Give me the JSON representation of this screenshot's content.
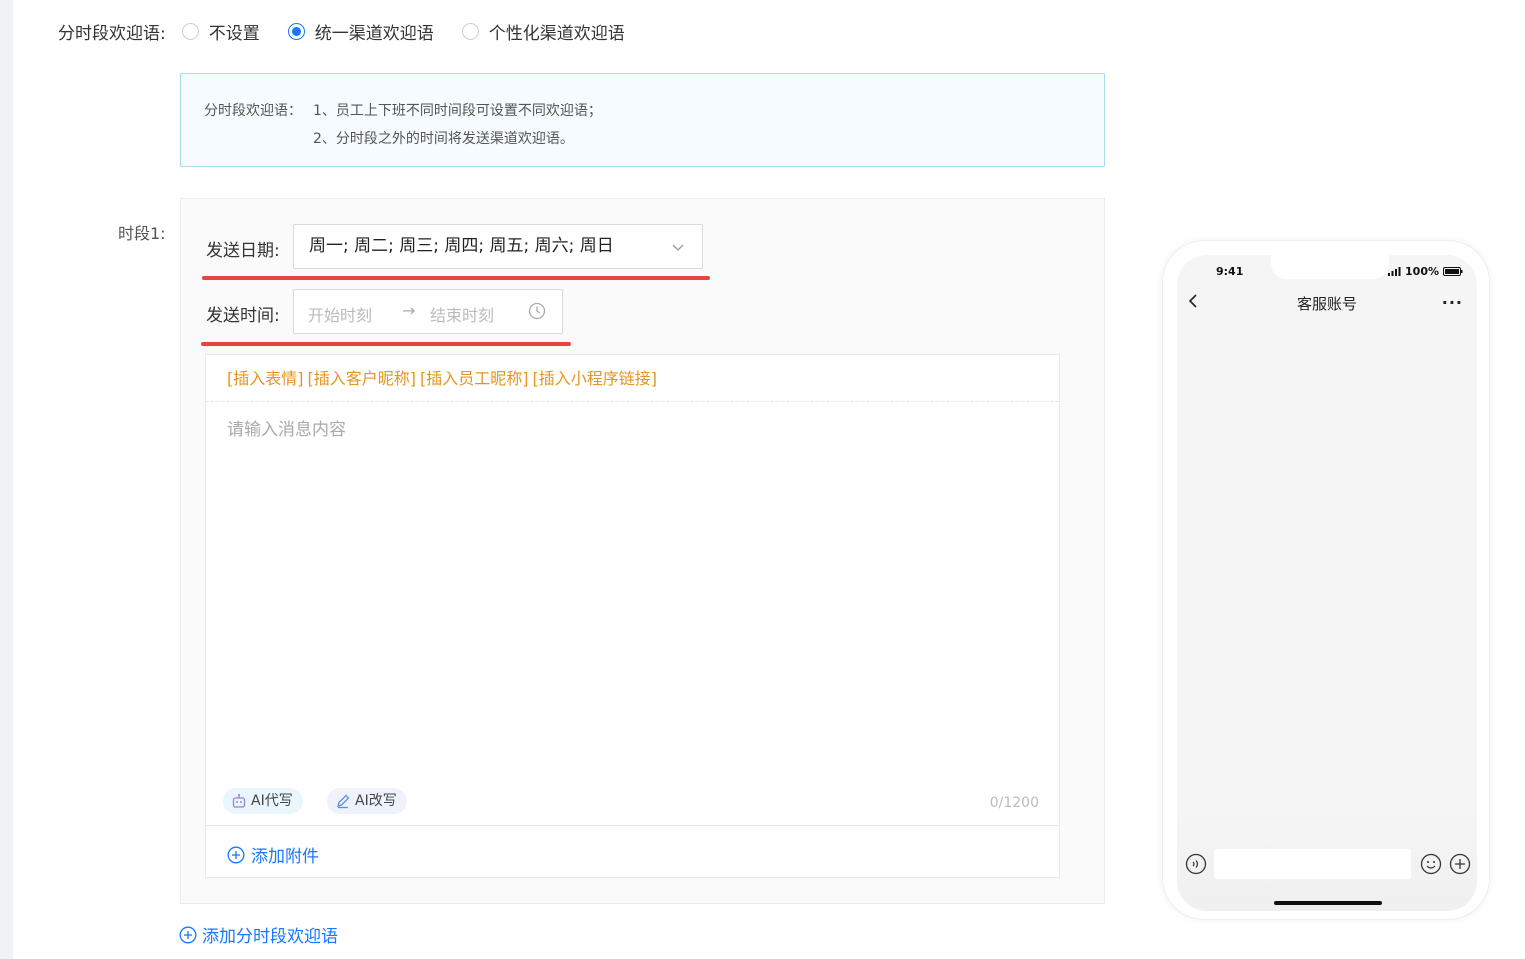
{
  "welcome_mode": {
    "label": "分时段欢迎语:",
    "options": [
      {
        "label": "不设置",
        "checked": false
      },
      {
        "label": "统一渠道欢迎语",
        "checked": true
      },
      {
        "label": "个性化渠道欢迎语",
        "checked": false
      }
    ]
  },
  "tip": {
    "label": "分时段欢迎语：",
    "line1": "1、员工上下班不同时间段可设置不同欢迎语；",
    "line2": "2、分时段之外的时间将发送渠道欢迎语。"
  },
  "period": {
    "label": "时段1:",
    "send_date_label": "发送日期:",
    "send_date_value": "周一; 周二; 周三; 周四; 周五; 周六; 周日",
    "send_time_label": "发送时间:",
    "start_placeholder": "开始时刻",
    "arrow": "→",
    "end_placeholder": "结束时刻"
  },
  "editor": {
    "insert_links": [
      "[插入表情]",
      "[插入客户昵称]",
      "[插入员工昵称]",
      "[插入小程序链接]"
    ],
    "placeholder": "请输入消息内容",
    "ai_write": "AI代写",
    "ai_rewrite": "AI改写",
    "counter": "0/1200",
    "add_attachment": "添加附件"
  },
  "add_period": "添加分时段欢迎语",
  "phone": {
    "time": "9:41",
    "battery": "100%",
    "title": "客服账号",
    "more": "···"
  },
  "colors": {
    "primary": "#1677ff",
    "accent_orange": "#e6951f",
    "underline_red": "#e8453c"
  }
}
